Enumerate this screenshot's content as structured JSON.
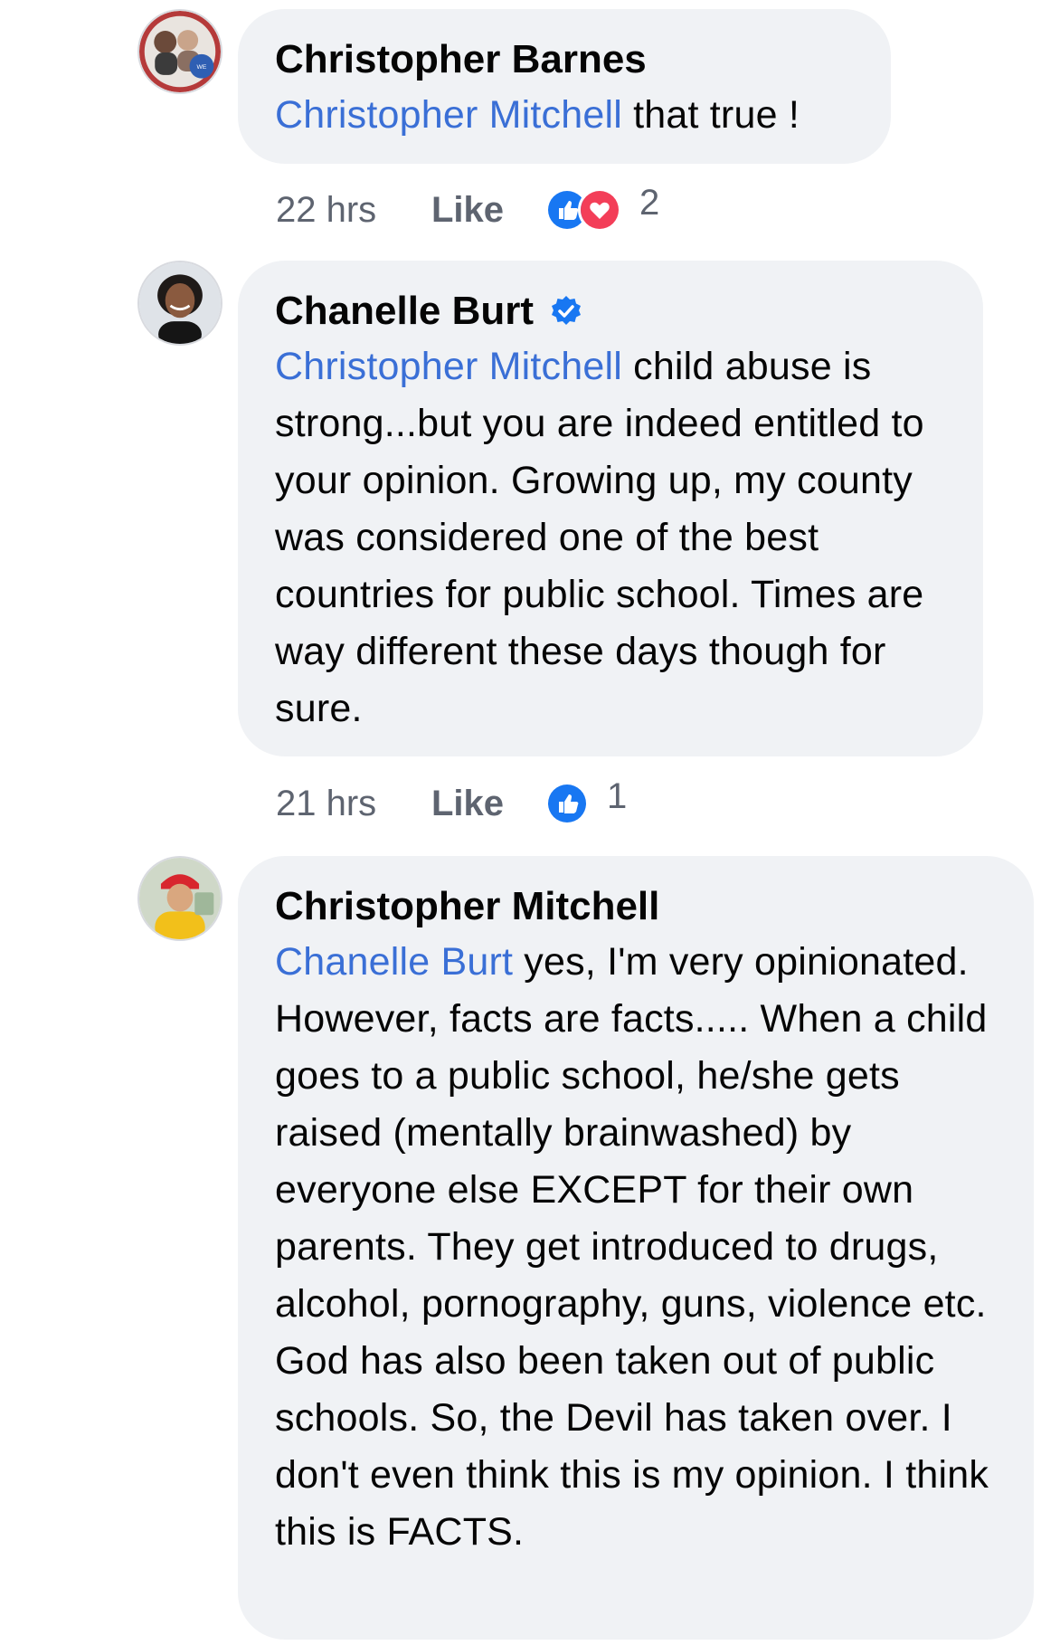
{
  "comments": [
    {
      "author": "Christopher Barnes",
      "verified": false,
      "mention": "Christopher Mitchell",
      "text": " that true !",
      "time": "22 hrs",
      "like_label": "Like",
      "reactions": [
        "like",
        "love"
      ],
      "reaction_count": "2"
    },
    {
      "author": "Chanelle Burt",
      "verified": true,
      "mention": "Christopher Mitchell",
      "text": " child abuse is strong...but you are indeed entitled to your opinion.  Growing up, my county was considered one of the best countries for public school. Times are way different these days though for sure.",
      "time": "21 hrs",
      "like_label": "Like",
      "reactions": [
        "like"
      ],
      "reaction_count": "1"
    },
    {
      "author": "Christopher Mitchell",
      "verified": false,
      "mention": "Chanelle Burt",
      "text": " yes, I'm very opinionated. However, facts are facts..... When a child goes to a public school, he/she gets raised (mentally brainwashed) by everyone else EXCEPT for their own parents. They get introduced to drugs, alcohol, pornography, guns, violence etc. God has also been taken out of public schools. So, the Devil has taken over. I don't even think this is my opinion. I think this is FACTS."
    }
  ],
  "colors": {
    "bubble": "#f0f2f5",
    "mention": "#3a6fd6",
    "like_reaction": "#1877f2",
    "love_reaction": "#f33e58",
    "meta_text": "#5e6470"
  },
  "icons": {
    "verified": "verified-badge-icon",
    "like": "thumbs-up-reaction-icon",
    "love": "heart-reaction-icon"
  }
}
